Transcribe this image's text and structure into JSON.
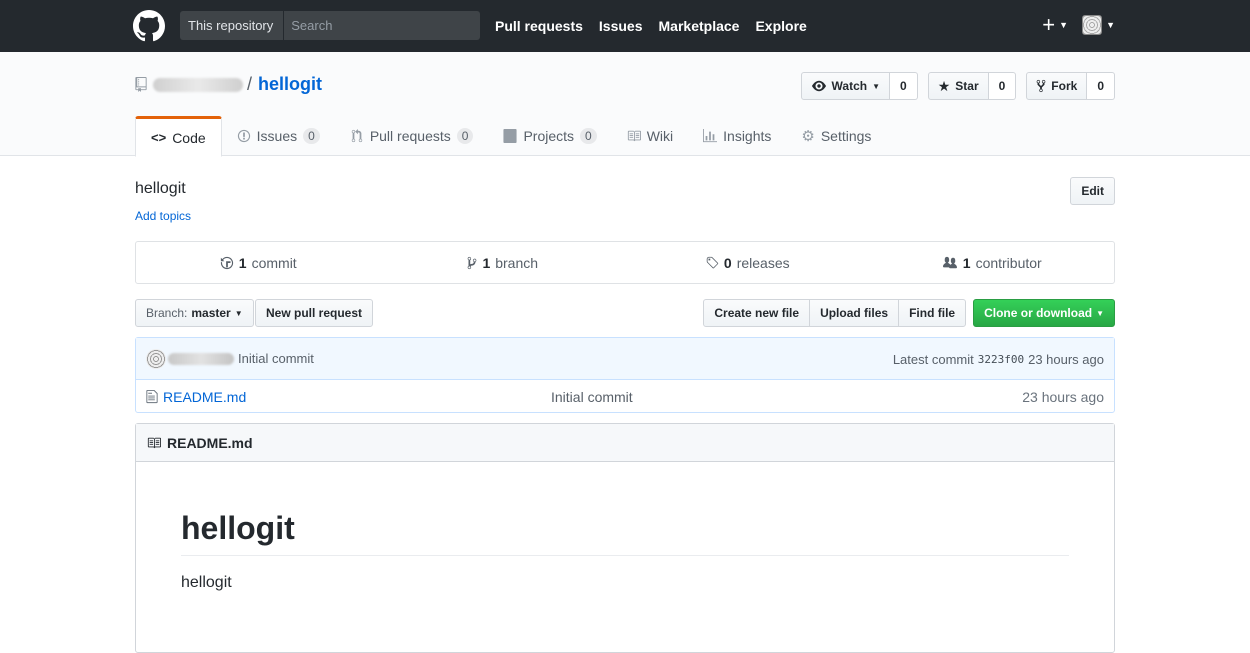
{
  "topbar": {
    "search_scope": "This repository",
    "search_placeholder": "Search",
    "nav": [
      "Pull requests",
      "Issues",
      "Marketplace",
      "Explore"
    ],
    "plus_label": "+"
  },
  "repo": {
    "separator": "/",
    "name": "hellogit",
    "watch_label": "Watch",
    "watch_count": "0",
    "star_label": "Star",
    "star_count": "0",
    "fork_label": "Fork",
    "fork_count": "0"
  },
  "tabs": [
    {
      "label": "Code",
      "counter": null
    },
    {
      "label": "Issues",
      "counter": "0"
    },
    {
      "label": "Pull requests",
      "counter": "0"
    },
    {
      "label": "Projects",
      "counter": "0"
    },
    {
      "label": "Wiki",
      "counter": null
    },
    {
      "label": "Insights",
      "counter": null
    },
    {
      "label": "Settings",
      "counter": null
    }
  ],
  "description": "hellogit",
  "add_topics": "Add topics",
  "edit_label": "Edit",
  "summary": {
    "commits_num": "1",
    "commits_label": "commit",
    "branches_num": "1",
    "branches_label": "branch",
    "releases_num": "0",
    "releases_label": "releases",
    "contributors_num": "1",
    "contributors_label": "contributor"
  },
  "filenav": {
    "branch_prefix": "Branch:",
    "branch_name": "master",
    "new_pr": "New pull request",
    "create_file": "Create new file",
    "upload_files": "Upload files",
    "find_file": "Find file",
    "clone": "Clone or download"
  },
  "commit": {
    "message": "Initial commit",
    "latest_label": "Latest commit",
    "sha": "3223f00",
    "age": "23 hours ago"
  },
  "files": [
    {
      "name": "README.md",
      "message": "Initial commit",
      "age": "23 hours ago"
    }
  ],
  "readme": {
    "title": "README.md",
    "h1": "hellogit",
    "p": "hellogit"
  }
}
